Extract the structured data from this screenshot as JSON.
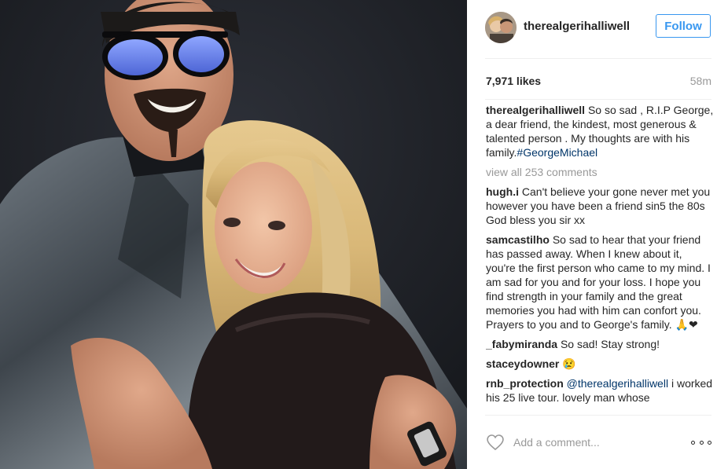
{
  "post": {
    "username": "therealgerihalliwell",
    "follow_label": "Follow",
    "likes": "7,971 likes",
    "time": "58m",
    "caption": {
      "user": "therealgerihalliwell",
      "text": "So so sad , R.I.P George, a dear friend, the kindest, most generous & talented person . My thoughts are with his family.",
      "hashtag": "#GeorgeMichael"
    },
    "view_all": "view all 253 comments",
    "comments": [
      {
        "user": "hugh.i",
        "text": "Can't believe your gone never met you however you have been a friend sin5 the 80s God bless you sir xx"
      },
      {
        "user": "samcastilho",
        "text": "So sad to hear that your friend has passed away. When I knew about it, you're the first person who came to my mind. I am sad for you and for your loss. I hope you find strength in your family and the great memories you had with him can confort you. Prayers to you and to George's family. 🙏❤"
      },
      {
        "user": "_fabymiranda",
        "text": "So sad! Stay strong!"
      },
      {
        "user": "staceydowner",
        "text": "😢"
      },
      {
        "user": "rnb_protection",
        "mention": "@therealgerihalliwell",
        "text": "i worked his 25 live tour. lovely man whose"
      }
    ],
    "add_comment_placeholder": "Add a comment...",
    "icons": {
      "heart": "heart-outline-icon",
      "more": "more-options-icon"
    },
    "colors": {
      "link": "#3897f0",
      "hashtag": "#003569",
      "muted": "#999999",
      "text": "#262626"
    }
  }
}
